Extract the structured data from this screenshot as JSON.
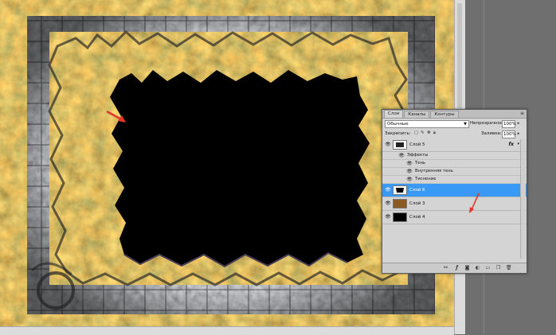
{
  "layers_panel": {
    "tabs": [
      "Слои",
      "Каналы",
      "Контуры"
    ],
    "blend_mode": "Обычные",
    "opacity_label": "Непрозрачность:",
    "opacity_value": "100%",
    "lock_label": "Закрепить:",
    "fill_label": "Заливка:",
    "fill_value": "100%",
    "layers": [
      {
        "name": "Слой 5",
        "has_fx": true,
        "fx_label": "fx",
        "selected": false
      },
      {
        "name": "Слой 6",
        "selected": true
      },
      {
        "name": "Слой 3",
        "selected": false
      },
      {
        "name": "Слой 4",
        "selected": false
      }
    ],
    "effects_group_label": "Эффекты",
    "effects": [
      "Тень",
      "Внутренняя тень",
      "Тиснение"
    ]
  },
  "colors": {
    "selection": "#3a99f5",
    "panel_bg": "#d4d4d4",
    "arrow_annotation": "#e4362b"
  }
}
